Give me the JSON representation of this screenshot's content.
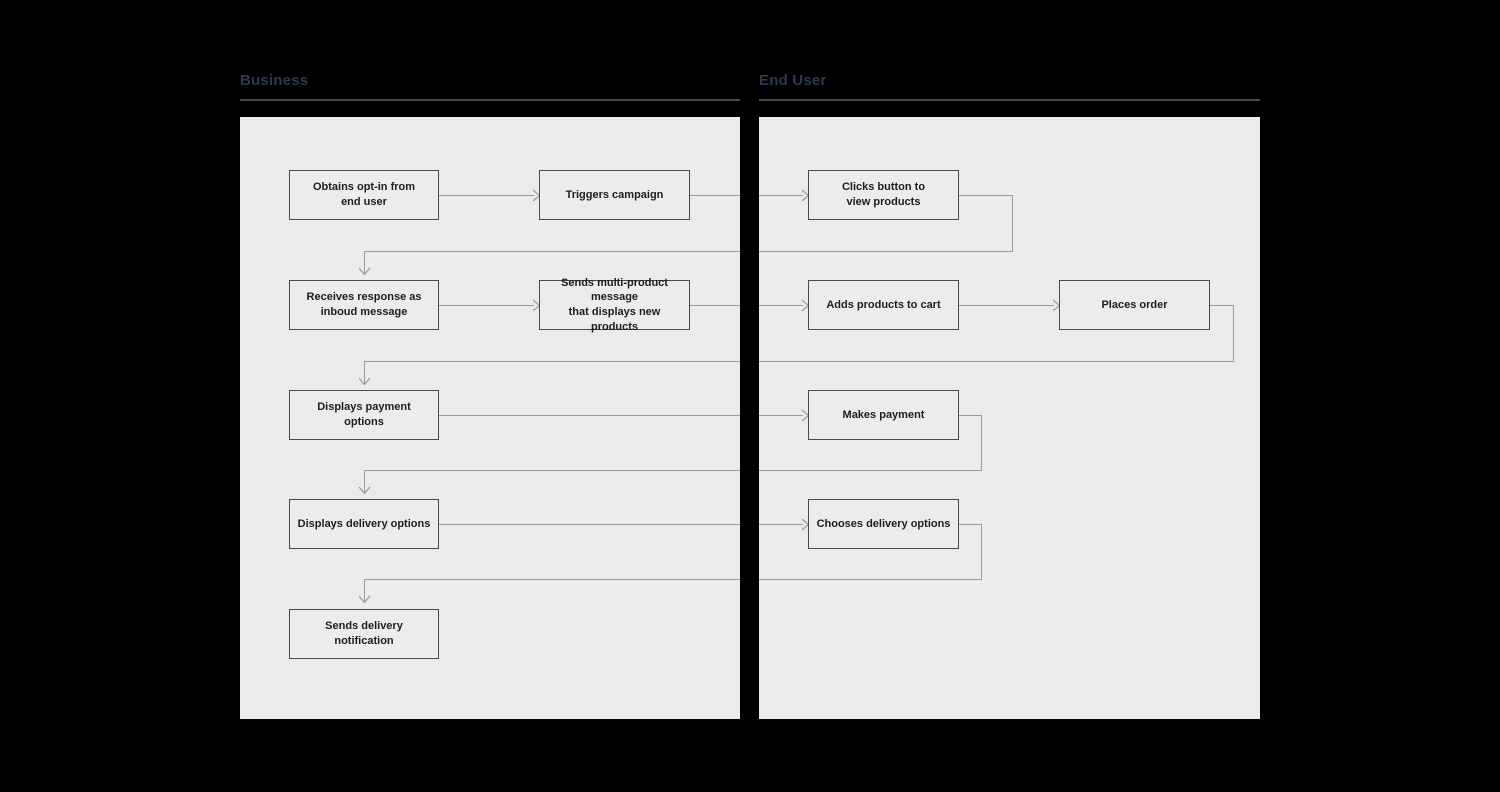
{
  "diagram": {
    "type": "swimlane-flowchart",
    "background_color": "#000000",
    "lane_fill": "#ebebeb",
    "node_fill": "#ececec",
    "node_border_color": "#4a4a4a",
    "connector_color": "#9b9b9b",
    "header_text_color": "#2e3a52",
    "lanes": [
      {
        "id": "business",
        "label": "Business"
      },
      {
        "id": "end_user",
        "label": "End User"
      }
    ],
    "nodes": [
      {
        "id": "n1",
        "lane": "business",
        "row": 1,
        "label": "Obtains opt-in from\nend user",
        "line1": "Obtains opt-in from",
        "line2": "end user"
      },
      {
        "id": "n2",
        "lane": "business",
        "row": 1,
        "label": "Triggers campaign",
        "line1": "Triggers campaign",
        "line2": ""
      },
      {
        "id": "n3",
        "lane": "end_user",
        "row": 1,
        "label": "Clicks button to\nview products",
        "line1": "Clicks button to",
        "line2": "view products"
      },
      {
        "id": "n4",
        "lane": "business",
        "row": 2,
        "label": "Receives response as\ninboud message",
        "line1": "Receives response as",
        "line2": "inboud message"
      },
      {
        "id": "n5",
        "lane": "business",
        "row": 2,
        "label": "Sends multi-product message\nthat displays new products",
        "line1": "Sends multi-product message",
        "line2": "that displays new products"
      },
      {
        "id": "n6",
        "lane": "end_user",
        "row": 2,
        "label": "Adds products to cart",
        "line1": "Adds products to cart",
        "line2": ""
      },
      {
        "id": "n7",
        "lane": "end_user",
        "row": 2,
        "label": "Places order",
        "line1": "Places order",
        "line2": ""
      },
      {
        "id": "n8",
        "lane": "business",
        "row": 3,
        "label": "Displays payment options",
        "line1": "Displays payment options",
        "line2": ""
      },
      {
        "id": "n9",
        "lane": "end_user",
        "row": 3,
        "label": "Makes payment",
        "line1": "Makes payment",
        "line2": ""
      },
      {
        "id": "n10",
        "lane": "business",
        "row": 4,
        "label": "Displays delivery options",
        "line1": "Displays delivery options",
        "line2": ""
      },
      {
        "id": "n11",
        "lane": "end_user",
        "row": 4,
        "label": "Chooses delivery options",
        "line1": "Chooses delivery options",
        "line2": ""
      },
      {
        "id": "n12",
        "lane": "business",
        "row": 5,
        "label": "Sends delivery notification",
        "line1": "Sends delivery notification",
        "line2": ""
      }
    ],
    "edges": [
      {
        "from": "n1",
        "to": "n2",
        "kind": "straight-right"
      },
      {
        "from": "n2",
        "to": "n3",
        "kind": "straight-right-cross-lane"
      },
      {
        "from": "n3",
        "to": "n4",
        "kind": "return-loop-down-left"
      },
      {
        "from": "n4",
        "to": "n5",
        "kind": "straight-right"
      },
      {
        "from": "n5",
        "to": "n6",
        "kind": "straight-right-cross-lane"
      },
      {
        "from": "n6",
        "to": "n7",
        "kind": "straight-right"
      },
      {
        "from": "n7",
        "to": "n8",
        "kind": "return-loop-down-left"
      },
      {
        "from": "n8",
        "to": "n9",
        "kind": "straight-right-cross-lane"
      },
      {
        "from": "n9",
        "to": "n10",
        "kind": "return-loop-down-left"
      },
      {
        "from": "n10",
        "to": "n11",
        "kind": "straight-right-cross-lane"
      },
      {
        "from": "n11",
        "to": "n12",
        "kind": "return-loop-down-left"
      }
    ]
  }
}
